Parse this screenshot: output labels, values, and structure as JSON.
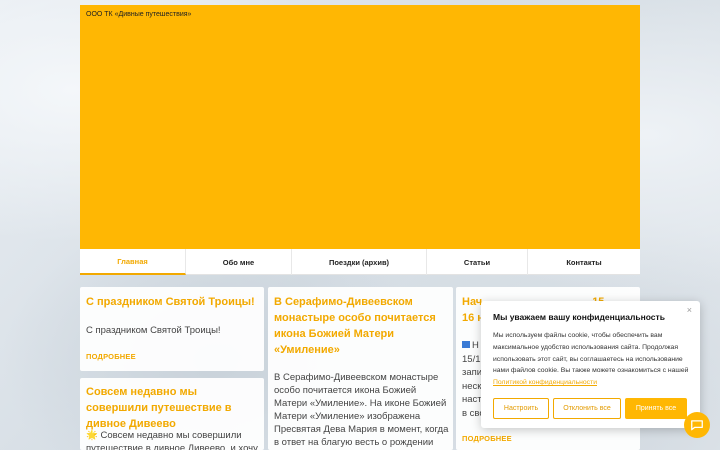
{
  "header": {
    "brand": "ООО ТК «Дивные путешествия»",
    "bg_color": "#ffb703"
  },
  "nav": {
    "items": [
      {
        "label": "Главная",
        "active": true
      },
      {
        "label": "Обо мне",
        "active": false
      },
      {
        "label": "Поездки (архив)",
        "active": false
      },
      {
        "label": "Статьи",
        "active": false
      },
      {
        "label": "Контакты",
        "active": false
      }
    ]
  },
  "cards": [
    {
      "title": "С праздником Святой Троицы!",
      "text": "С праздником Святой Троицы!",
      "more": "ПОДРОБНЕЕ"
    },
    {
      "title": "Совсем недавно мы совершили путешествие в дивное Дивеево",
      "text_icon": "🌟",
      "text": "Совсем недавно мы совершили путешествие в дивное Дивеево, и хочу"
    },
    {
      "title": "В Серафимо-Дивеевском монастыре особо почитается икона Божией Матери «Умиление»",
      "text": "В Серафимо-Дивеевском монастыре особо почитается икона Божией Матери «Умиление». На иконе Божией Матери «Умиление» изображена Пресвятая Дева Мария в момент, когда в ответ на благую весть о рождении Спасителя"
    },
    {
      "title_visible": "Нач...                     ...15",
      "title_line1_start": "Нач",
      "title_line1_end": "15",
      "title_line2_start": "16 н",
      "text_lines_start": [
        "Н",
        "15/1",
        "запи",
        "неск",
        "наст",
        "в сво"
      ],
      "more": "ПОДРОБНЕЕ"
    }
  ],
  "cookie": {
    "close": "×",
    "title": "Мы уважаем вашу конфиденциальность",
    "text": "Мы используем файлы cookie, чтобы обеспечить вам максимальное удобство использования сайта. Продолжая использовать этот сайт, вы соглашаетесь на использование нами файлов cookie. Вы также можете ознакомиться с нашей",
    "link": "Политикой конфиденциальности",
    "buttons": {
      "configure": "Настроить",
      "reject": "Отклонить все",
      "accept": "Принять все"
    }
  },
  "colors": {
    "accent": "#f2a900",
    "header_bg": "#ffb703"
  },
  "icons": {
    "chat": "chat-icon"
  }
}
